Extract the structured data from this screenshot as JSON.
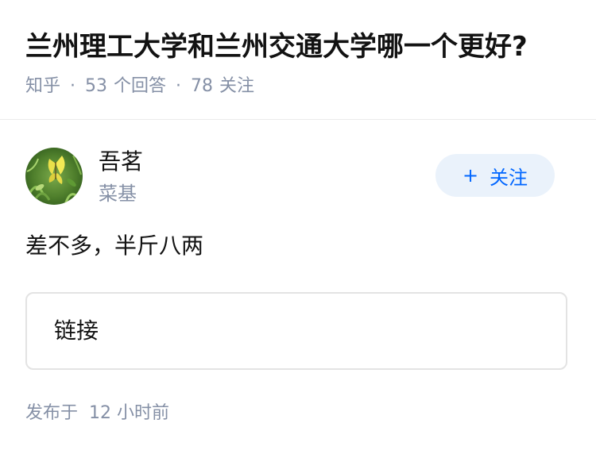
{
  "question": {
    "title": "兰州理工大学和兰州交通大学哪一个更好?",
    "source": "知乎",
    "answer_count": "53",
    "answer_label": "个回答",
    "follower_count": "78",
    "follower_label": "关注",
    "separator": "·"
  },
  "author": {
    "name": "吾茗",
    "bio": "菜基",
    "avatar_icon": "butterfly-avatar",
    "follow_plus": "+",
    "follow_label": "关注"
  },
  "answer": {
    "text": "差不多，半斤八两",
    "link_label": "链接",
    "publish_label": "发布于",
    "publish_time": "12 小时前"
  },
  "colors": {
    "accent": "#0066ff",
    "follow_bg": "#eaf2fb",
    "meta_text": "#8590a6"
  }
}
